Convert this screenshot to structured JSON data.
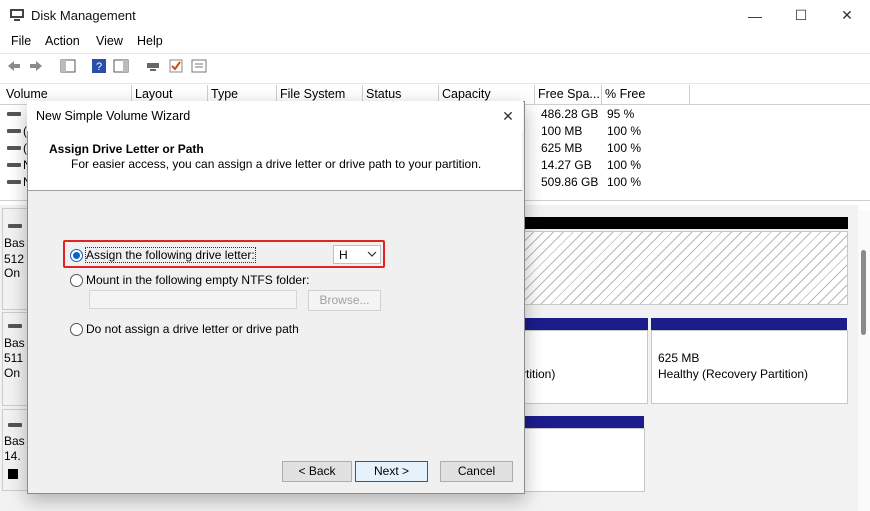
{
  "window": {
    "title": "Disk Management",
    "controls": {
      "minimize": "—",
      "maximize": "☐",
      "close": "✕"
    }
  },
  "menu": [
    "File",
    "Action",
    "View",
    "Help"
  ],
  "toolbar_icons": [
    "back-arrow-icon",
    "forward-arrow-icon",
    "console-tree-icon",
    "help-icon",
    "action-pane-icon",
    "connect-icon",
    "check-icon",
    "properties-icon"
  ],
  "volume_list": {
    "columns": [
      "Volume",
      "Layout",
      "Type",
      "File System",
      "Status",
      "Capacity",
      "Free Spa...",
      "% Free"
    ],
    "rows": [
      {
        "volume": "",
        "free": "486.28 GB",
        "pct": "95 %"
      },
      {
        "volume": "(",
        "free": "100 MB",
        "pct": "100 %"
      },
      {
        "volume": "(",
        "free": "625 MB",
        "pct": "100 %"
      },
      {
        "volume": "N",
        "free": "14.27 GB",
        "pct": "100 %"
      },
      {
        "volume": "N",
        "free": "509.86 GB",
        "pct": "100 %"
      }
    ]
  },
  "disks": [
    {
      "line1": "Bas",
      "line2": "512",
      "line3": "On"
    },
    {
      "line1": "Bas",
      "line2": "511",
      "line3": "On"
    },
    {
      "line1": "Bas",
      "line2": "14.",
      "line3": ""
    }
  ],
  "partitions": {
    "disk1_partial_label": "rtition)",
    "recovery_size": "625 MB",
    "recovery_status": "Healthy (Recovery Partition)"
  },
  "dialog": {
    "title": "New Simple Volume Wizard",
    "close": "✕",
    "heading": "Assign Drive Letter or Path",
    "subheading": "For easier access, you can assign a drive letter or drive path to your partition.",
    "option_assign": "Assign the following drive letter:",
    "drive_letter": "H",
    "option_mount": "Mount in the following empty NTFS folder:",
    "browse": "Browse...",
    "option_none": "Do not assign a drive letter or drive path",
    "back": "< Back",
    "next": "Next >",
    "cancel": "Cancel"
  },
  "colors": {
    "highlight": "#e52222",
    "accent": "#0a63c9",
    "partition_bar": "#1c1c8c"
  }
}
